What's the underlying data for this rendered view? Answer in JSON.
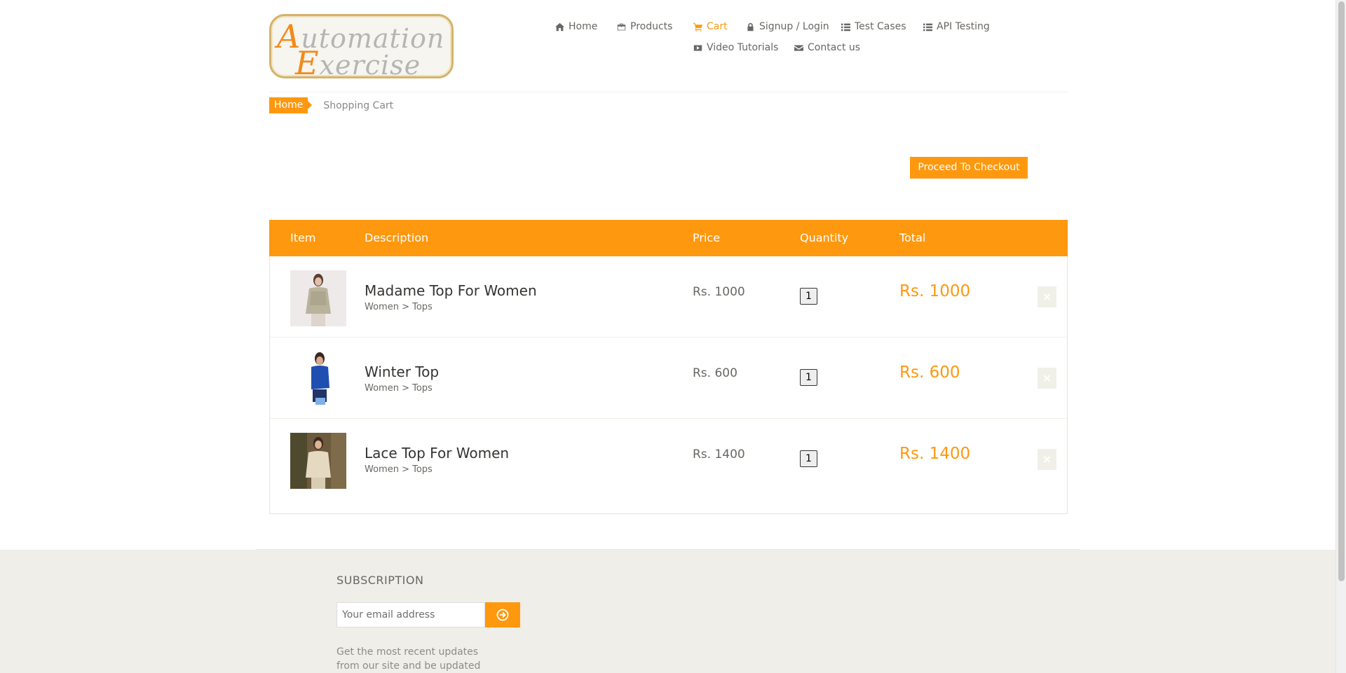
{
  "header": {
    "logo": {
      "line1_cap": "A",
      "line1_rest": "utomation",
      "line2_cap": "E",
      "line2_rest": "xercise"
    },
    "nav": [
      {
        "label": "Home",
        "icon": "home-icon"
      },
      {
        "label": "Products",
        "icon": "briefcase-icon"
      },
      {
        "label": "Cart",
        "icon": "cart-icon",
        "active": true
      },
      {
        "label": "Signup / Login",
        "icon": "lock-icon"
      },
      {
        "label": "Test Cases",
        "icon": "list-icon"
      },
      {
        "label": "API Testing",
        "icon": "list-icon"
      },
      {
        "label": "Video Tutorials",
        "icon": "youtube-play-icon"
      },
      {
        "label": "Contact us",
        "icon": "envelope-icon"
      }
    ]
  },
  "breadcrumb": {
    "home": "Home",
    "current": "Shopping Cart"
  },
  "checkout_label": "Proceed To Checkout",
  "cart": {
    "columns": [
      "Item",
      "Description",
      "Price",
      "Quantity",
      "Total"
    ],
    "rows": [
      {
        "name": "Madame Top For Women",
        "category": "Women > Tops",
        "price": "Rs. 1000",
        "quantity": "1",
        "total": "Rs. 1000"
      },
      {
        "name": "Winter Top",
        "category": "Women > Tops",
        "price": "Rs. 600",
        "quantity": "1",
        "total": "Rs. 600"
      },
      {
        "name": "Lace Top For Women",
        "category": "Women > Tops",
        "price": "Rs. 1400",
        "quantity": "1",
        "total": "Rs. 1400"
      }
    ],
    "delete_symbol": "×"
  },
  "footer": {
    "subscription_title": "SUBSCRIPTION",
    "email_placeholder": "Your email address",
    "description": "Get the most recent updates from our site and be updated your self..."
  },
  "colors": {
    "accent": "#fe980f",
    "text": "#696763",
    "footer_bg": "#efeee9"
  }
}
